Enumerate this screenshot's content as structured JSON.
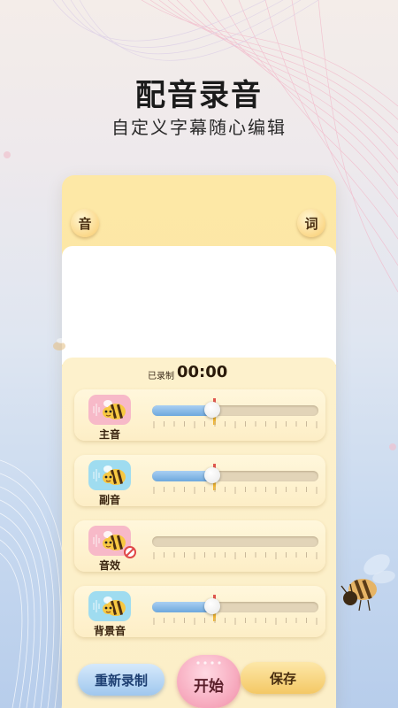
{
  "header": {
    "title": "配音录音",
    "subtitle": "自定义字幕随心编辑"
  },
  "card": {
    "left_button": "音",
    "right_button": "词"
  },
  "recorder": {
    "status_label": "已录制",
    "time": "00:00"
  },
  "tracks": [
    {
      "label": "主音",
      "icon": "bee-icon",
      "icon_bg": "#f7b9c8",
      "volume": 0.36,
      "marker": 0.37,
      "muted": false
    },
    {
      "label": "副音",
      "icon": "bee-icon",
      "icon_bg": "#9fdcf0",
      "volume": 0.36,
      "marker": 0.37,
      "muted": false
    },
    {
      "label": "音效",
      "icon": "bee-icon",
      "icon_bg": "#f7b9c8",
      "volume": null,
      "marker": null,
      "muted": true
    },
    {
      "label": "背景音",
      "icon": "bee-icon",
      "icon_bg": "#9fdcf0",
      "volume": 0.36,
      "marker": 0.37,
      "muted": false
    }
  ],
  "actions": {
    "rerecord": "重新录制",
    "start": "开始",
    "save": "保存"
  },
  "colors": {
    "accent_blue": "#6ea8dd",
    "marker_red": "#e0574f",
    "marker_yellow": "#f2b632",
    "card_yellow": "#fde8a6"
  }
}
